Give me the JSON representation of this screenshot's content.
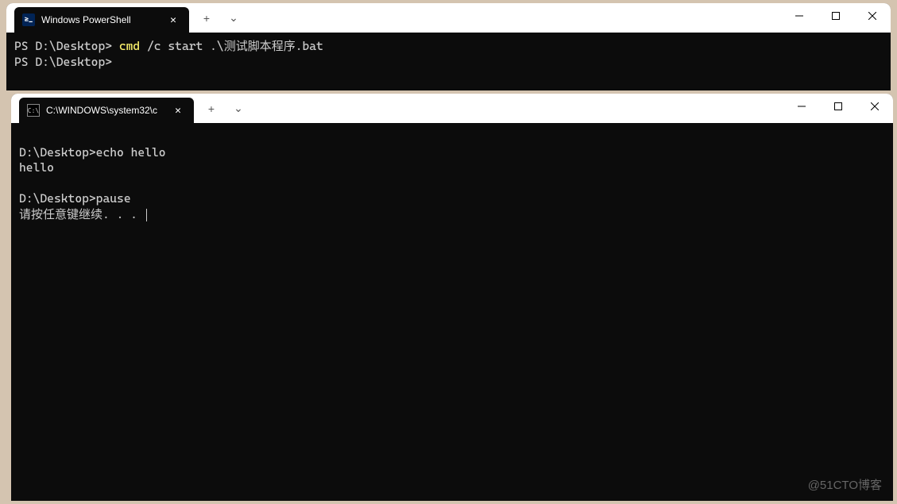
{
  "window1": {
    "tab": {
      "title": "Windows PowerShell",
      "icon_text": "≥_"
    },
    "content": {
      "line1_prompt": "PS D:\\Desktop> ",
      "line1_cmd": "cmd",
      "line1_rest": " /c start .\\测试脚本程序.bat",
      "line2_prompt": "PS D:\\Desktop>"
    }
  },
  "window2": {
    "tab": {
      "title": "C:\\WINDOWS\\system32\\c",
      "icon_text": "C:\\"
    },
    "content": {
      "line1": "D:\\Desktop>echo hello",
      "line2": "hello",
      "line3": "",
      "line4": "D:\\Desktop>pause",
      "line5": "请按任意键继续. . . "
    }
  },
  "watermark": "@51CTO博客",
  "icons": {
    "plus": "+",
    "chevron": "⌄",
    "close": "✕"
  }
}
